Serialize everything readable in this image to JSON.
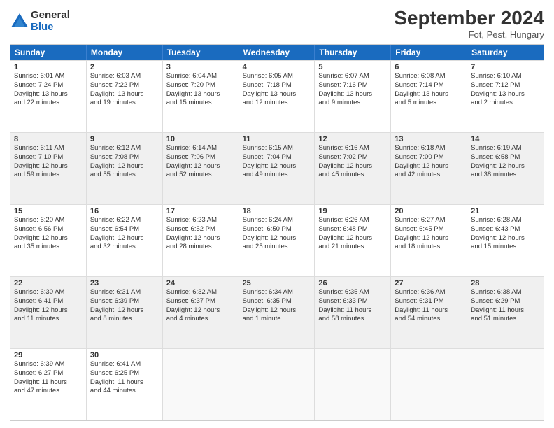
{
  "logo": {
    "general": "General",
    "blue": "Blue"
  },
  "header": {
    "title": "September 2024",
    "subtitle": "Fot, Pest, Hungary"
  },
  "days": [
    "Sunday",
    "Monday",
    "Tuesday",
    "Wednesday",
    "Thursday",
    "Friday",
    "Saturday"
  ],
  "rows": [
    [
      {
        "day": "",
        "empty": true
      },
      {
        "day": "",
        "empty": true
      },
      {
        "day": "",
        "empty": true
      },
      {
        "day": "",
        "empty": true
      },
      {
        "day": "",
        "empty": true
      },
      {
        "day": "",
        "empty": true
      },
      {
        "day": "",
        "empty": true
      }
    ]
  ],
  "cells": {
    "r1": [
      {
        "num": "1",
        "l1": "Sunrise: 6:01 AM",
        "l2": "Sunset: 7:24 PM",
        "l3": "Daylight: 13 hours",
        "l4": "and 22 minutes."
      },
      {
        "num": "2",
        "l1": "Sunrise: 6:03 AM",
        "l2": "Sunset: 7:22 PM",
        "l3": "Daylight: 13 hours",
        "l4": "and 19 minutes."
      },
      {
        "num": "3",
        "l1": "Sunrise: 6:04 AM",
        "l2": "Sunset: 7:20 PM",
        "l3": "Daylight: 13 hours",
        "l4": "and 15 minutes."
      },
      {
        "num": "4",
        "l1": "Sunrise: 6:05 AM",
        "l2": "Sunset: 7:18 PM",
        "l3": "Daylight: 13 hours",
        "l4": "and 12 minutes."
      },
      {
        "num": "5",
        "l1": "Sunrise: 6:07 AM",
        "l2": "Sunset: 7:16 PM",
        "l3": "Daylight: 13 hours",
        "l4": "and 9 minutes."
      },
      {
        "num": "6",
        "l1": "Sunrise: 6:08 AM",
        "l2": "Sunset: 7:14 PM",
        "l3": "Daylight: 13 hours",
        "l4": "and 5 minutes."
      },
      {
        "num": "7",
        "l1": "Sunrise: 6:10 AM",
        "l2": "Sunset: 7:12 PM",
        "l3": "Daylight: 13 hours",
        "l4": "and 2 minutes."
      }
    ],
    "r2": [
      {
        "num": "8",
        "l1": "Sunrise: 6:11 AM",
        "l2": "Sunset: 7:10 PM",
        "l3": "Daylight: 12 hours",
        "l4": "and 59 minutes."
      },
      {
        "num": "9",
        "l1": "Sunrise: 6:12 AM",
        "l2": "Sunset: 7:08 PM",
        "l3": "Daylight: 12 hours",
        "l4": "and 55 minutes."
      },
      {
        "num": "10",
        "l1": "Sunrise: 6:14 AM",
        "l2": "Sunset: 7:06 PM",
        "l3": "Daylight: 12 hours",
        "l4": "and 52 minutes."
      },
      {
        "num": "11",
        "l1": "Sunrise: 6:15 AM",
        "l2": "Sunset: 7:04 PM",
        "l3": "Daylight: 12 hours",
        "l4": "and 49 minutes."
      },
      {
        "num": "12",
        "l1": "Sunrise: 6:16 AM",
        "l2": "Sunset: 7:02 PM",
        "l3": "Daylight: 12 hours",
        "l4": "and 45 minutes."
      },
      {
        "num": "13",
        "l1": "Sunrise: 6:18 AM",
        "l2": "Sunset: 7:00 PM",
        "l3": "Daylight: 12 hours",
        "l4": "and 42 minutes."
      },
      {
        "num": "14",
        "l1": "Sunrise: 6:19 AM",
        "l2": "Sunset: 6:58 PM",
        "l3": "Daylight: 12 hours",
        "l4": "and 38 minutes."
      }
    ],
    "r3": [
      {
        "num": "15",
        "l1": "Sunrise: 6:20 AM",
        "l2": "Sunset: 6:56 PM",
        "l3": "Daylight: 12 hours",
        "l4": "and 35 minutes."
      },
      {
        "num": "16",
        "l1": "Sunrise: 6:22 AM",
        "l2": "Sunset: 6:54 PM",
        "l3": "Daylight: 12 hours",
        "l4": "and 32 minutes."
      },
      {
        "num": "17",
        "l1": "Sunrise: 6:23 AM",
        "l2": "Sunset: 6:52 PM",
        "l3": "Daylight: 12 hours",
        "l4": "and 28 minutes."
      },
      {
        "num": "18",
        "l1": "Sunrise: 6:24 AM",
        "l2": "Sunset: 6:50 PM",
        "l3": "Daylight: 12 hours",
        "l4": "and 25 minutes."
      },
      {
        "num": "19",
        "l1": "Sunrise: 6:26 AM",
        "l2": "Sunset: 6:48 PM",
        "l3": "Daylight: 12 hours",
        "l4": "and 21 minutes."
      },
      {
        "num": "20",
        "l1": "Sunrise: 6:27 AM",
        "l2": "Sunset: 6:45 PM",
        "l3": "Daylight: 12 hours",
        "l4": "and 18 minutes."
      },
      {
        "num": "21",
        "l1": "Sunrise: 6:28 AM",
        "l2": "Sunset: 6:43 PM",
        "l3": "Daylight: 12 hours",
        "l4": "and 15 minutes."
      }
    ],
    "r4": [
      {
        "num": "22",
        "l1": "Sunrise: 6:30 AM",
        "l2": "Sunset: 6:41 PM",
        "l3": "Daylight: 12 hours",
        "l4": "and 11 minutes."
      },
      {
        "num": "23",
        "l1": "Sunrise: 6:31 AM",
        "l2": "Sunset: 6:39 PM",
        "l3": "Daylight: 12 hours",
        "l4": "and 8 minutes."
      },
      {
        "num": "24",
        "l1": "Sunrise: 6:32 AM",
        "l2": "Sunset: 6:37 PM",
        "l3": "Daylight: 12 hours",
        "l4": "and 4 minutes."
      },
      {
        "num": "25",
        "l1": "Sunrise: 6:34 AM",
        "l2": "Sunset: 6:35 PM",
        "l3": "Daylight: 12 hours",
        "l4": "and 1 minute."
      },
      {
        "num": "26",
        "l1": "Sunrise: 6:35 AM",
        "l2": "Sunset: 6:33 PM",
        "l3": "Daylight: 11 hours",
        "l4": "and 58 minutes."
      },
      {
        "num": "27",
        "l1": "Sunrise: 6:36 AM",
        "l2": "Sunset: 6:31 PM",
        "l3": "Daylight: 11 hours",
        "l4": "and 54 minutes."
      },
      {
        "num": "28",
        "l1": "Sunrise: 6:38 AM",
        "l2": "Sunset: 6:29 PM",
        "l3": "Daylight: 11 hours",
        "l4": "and 51 minutes."
      }
    ],
    "r5": [
      {
        "num": "29",
        "l1": "Sunrise: 6:39 AM",
        "l2": "Sunset: 6:27 PM",
        "l3": "Daylight: 11 hours",
        "l4": "and 47 minutes."
      },
      {
        "num": "30",
        "l1": "Sunrise: 6:41 AM",
        "l2": "Sunset: 6:25 PM",
        "l3": "Daylight: 11 hours",
        "l4": "and 44 minutes."
      },
      {
        "num": "",
        "empty": true
      },
      {
        "num": "",
        "empty": true
      },
      {
        "num": "",
        "empty": true
      },
      {
        "num": "",
        "empty": true
      },
      {
        "num": "",
        "empty": true
      }
    ]
  }
}
